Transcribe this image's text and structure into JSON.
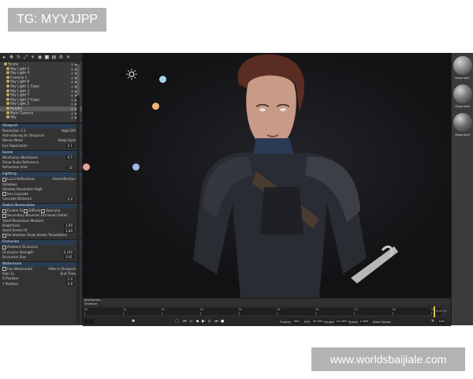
{
  "watermark_top": "TG: MYYJJPP",
  "watermark_bottom": "www.worldsbaijiale.com",
  "scene_tree": {
    "items": [
      {
        "label": "Scene",
        "selected": false
      },
      {
        "label": "Sky Light 1",
        "selected": false
      },
      {
        "label": "Sky Light 4",
        "selected": false
      },
      {
        "label": "Camera 1",
        "selected": false
      },
      {
        "label": "Sky Light 6",
        "selected": false
      },
      {
        "label": "Sky Light 1 Copy",
        "selected": false
      },
      {
        "label": "Sky Light 3",
        "selected": false
      },
      {
        "label": "Sky Light 7",
        "selected": false
      },
      {
        "label": "Sky Light 2 Copy",
        "selected": false
      },
      {
        "label": "Sky Light 5",
        "selected": false
      },
      {
        "label": "Render",
        "selected": true
      },
      {
        "label": "Main Camera",
        "selected": false
      },
      {
        "label": "Sky",
        "selected": false
      }
    ]
  },
  "viewport_section": {
    "title": "Viewport",
    "resolution_label": "Resolution",
    "resolution_value": "1:1",
    "resolution_right": "High-DPI",
    "antialiasing_label": "Anti-aliasing",
    "antialiasing_value": "4x Temporal",
    "stereo_label": "Stereo",
    "stereo_value": "None",
    "swap_eyes_label": "Swap Eyes",
    "eye_sep_label": "Eye Separation",
    "eye_sep_value": "0.1"
  },
  "scene_section": {
    "title": "Scene",
    "wireframe_label": "Wireframe",
    "wireframe_mode": "Wireframe",
    "wireframe_value": "0.5",
    "show_ref_label": "Show Scale Reference",
    "refraction_label": "Refraction limit",
    "refraction_value": "10"
  },
  "lighting_section": {
    "title": "Lighting",
    "local_refl_label": "Local Reflections",
    "interreflection_label": "Interreflection",
    "shadows_label": "Shadows",
    "shadow_res_label": "Shadow Resolution",
    "shadow_res_value": "High",
    "use_cascade_label": "Use Cascade",
    "cascade_dist_label": "Cascade Distance",
    "cascade_dist_value": "0.9"
  },
  "gi_section": {
    "title": "Global Illumination",
    "enable_gi_label": "Enable GI",
    "diffuse_label": "Diffuse",
    "specular_label": "Specular",
    "secondary_bounces_label": "Secondary Bounces",
    "occlusion_detail_label": "Occlusion Detail",
    "voxel_res_label": "Voxel Resolution",
    "voxel_res_value": "Medium",
    "brightness_label": "Brightness",
    "brightness_value": "1.00",
    "voxel_fit_label": "Voxel Scene Fit",
    "voxel_fit_value": "1.00",
    "revoxelize_label": "Re-Voxelize",
    "show_voxels_label": "Show Voxels",
    "tessellation_label": "Tessellation"
  },
  "occlusion_section": {
    "title": "Occlusion",
    "ambient_label": "Ambient Occlusion",
    "strength_label": "Occlusion Strength",
    "strength_value": "0.100",
    "size_label": "Occlusion Size",
    "size_value": "0.01"
  },
  "watermark_section": {
    "title": "Watermark",
    "use_label": "Use Watermark",
    "hide_label": "Hide in Viewport",
    "size_label": "Size",
    "size_value": "1x",
    "xpos_label": "X Position",
    "xpos_value": "1.0",
    "ypos_label": "Y Position",
    "ypos_value": "0.8",
    "end_label": "End",
    "time_label": "Time"
  },
  "materials": [
    {
      "label": "Material01",
      "color": "#8a8a8a"
    },
    {
      "label": "Material04",
      "color": "#7b7b7b"
    },
    {
      "label": "Material03",
      "color": "#6e6e6e"
    }
  ],
  "timeline": {
    "keyframes_label": "Keyframes",
    "timeline_label": "Timeline",
    "ticks": [
      "0s",
      "1s",
      "2s",
      "3s",
      "4s",
      "5s",
      "6s",
      "7s",
      "8s",
      "9s"
    ],
    "current_time": "0:09.10",
    "frames_label": "Frames",
    "frames_value": "300",
    "fps_label": "FPS",
    "fps_value": "30.000",
    "length_label": "Length",
    "length_value": "10.000",
    "speed_label": "Speed",
    "speed_value": "1.000",
    "bake_label": "Bake Speed",
    "zoom_value": "100"
  },
  "colors": {
    "panel_bg": "#333333",
    "section_header": "#2a3c52",
    "viewport_bg": "#121214",
    "accent_green": "#8fd46a",
    "playhead": "#e1c34a"
  }
}
